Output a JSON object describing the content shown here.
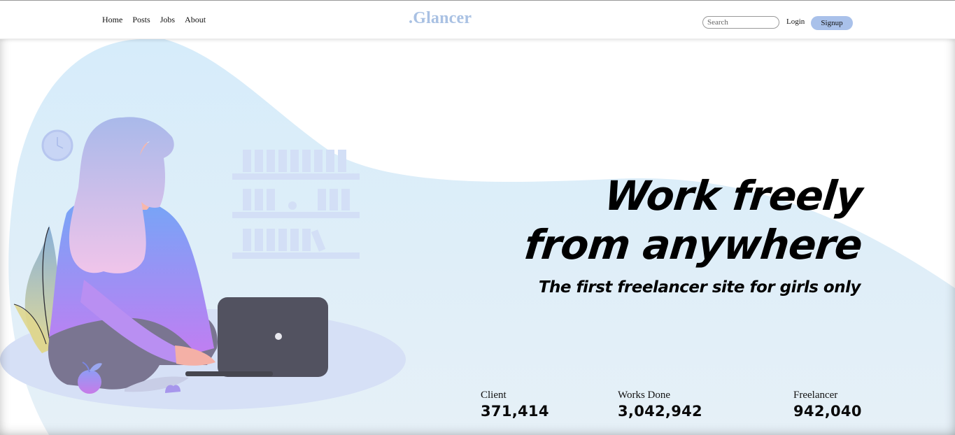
{
  "nav": {
    "links": [
      "Home",
      "Posts",
      "Jobs",
      "About"
    ],
    "brand": ".Glancer",
    "search_placeholder": "Search",
    "login_label": "Login",
    "signup_label": "Signup"
  },
  "hero": {
    "headline_line1": "Work freely",
    "headline_line2": "from anywhere",
    "subheadline": "The first freelancer site for girls only"
  },
  "stats": [
    {
      "label": "Client",
      "value": "371,414"
    },
    {
      "label": "Works Done",
      "value": "3,042,942"
    },
    {
      "label": "Freelancer",
      "value": "942,040"
    }
  ],
  "colors": {
    "brand": "#a9c1e3",
    "signup_bg": "#a9c1ea",
    "blob": "#dceef9",
    "laptop": "#525260"
  }
}
